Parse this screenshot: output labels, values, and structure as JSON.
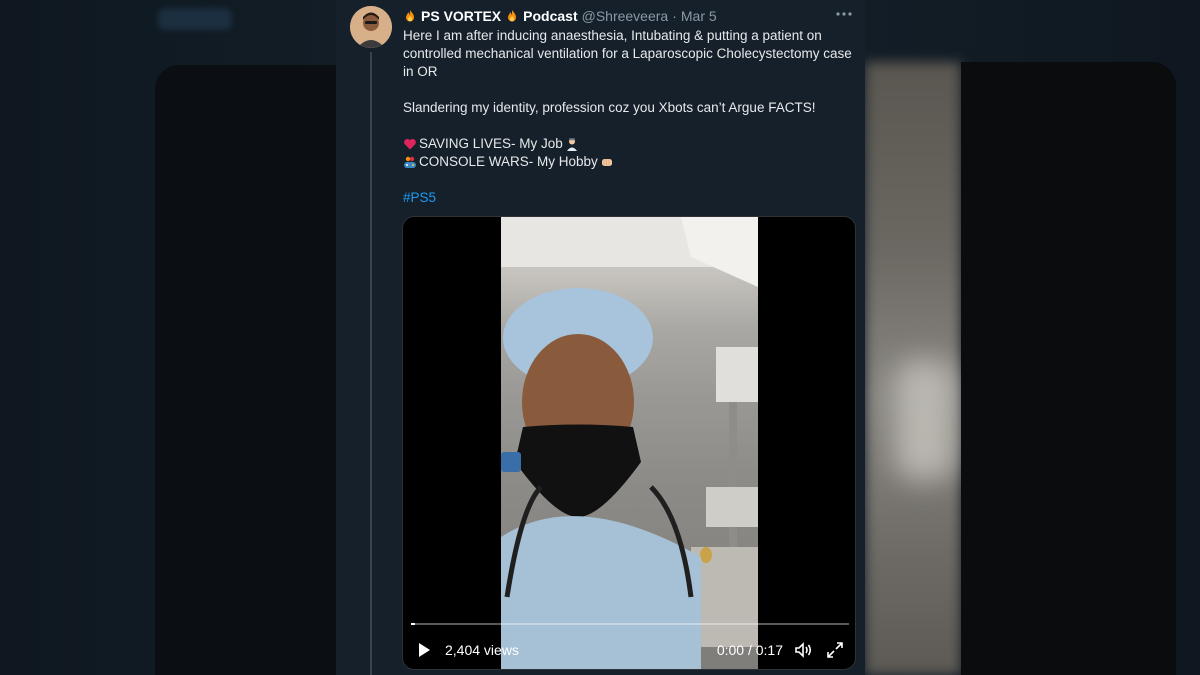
{
  "tweet": {
    "display_name": "PS VORTEX",
    "display_suffix": "Podcast",
    "handle": "@Shreeveera",
    "separator": "·",
    "date": "Mar 5",
    "text_intro": "Here I am after inducing anaesthesia, Intubating & putting a patient on controlled mechanical ventilation for a Laparoscopic Cholecystectomy case in OR",
    "text_second": "Slandering my identity, profession coz you Xbots can’t Argue FACTS!",
    "line_saving": "SAVING LIVES- My Job",
    "line_console": "CONSOLE WARS- My Hobby",
    "hashtag": "#PS5"
  },
  "video": {
    "views": "2,404 views",
    "time": "0:00 / 0:17",
    "progress_fraction": 0.01
  },
  "icons": {
    "more": "more-horizontal-icon",
    "play": "play-icon",
    "volume": "volume-icon",
    "fullscreen": "expand-icon"
  },
  "colors": {
    "background": "#15202b",
    "text": "#e7e9ea",
    "muted": "#8b98a5",
    "link": "#1d9bf0"
  }
}
